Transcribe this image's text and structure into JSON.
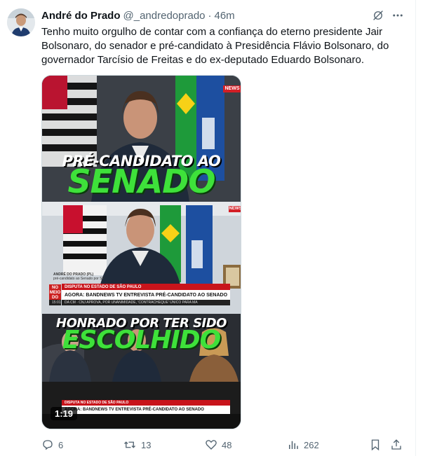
{
  "author": {
    "name": "André do Prado",
    "handle": "@_andredoprado",
    "separator": "·",
    "time": "46m"
  },
  "tweet": {
    "text": "Tenho muito orgulho de contar com a confiança do eterno presidente Jair Bolsonaro, do senador e pré-candidato à Presidência Flávio Bolsonaro, do governador Tarcísio de Freitas e do ex-deputado Eduardo Bolsonaro."
  },
  "video": {
    "duration": "1:19",
    "panel1": {
      "logo": "NEWS",
      "headline_white": "PRÉ-CANDIDATO AO",
      "headline_green": "SENADO"
    },
    "panel2": {
      "logo": "NEWS",
      "name_tag": "ANDRÉ DO PRADO (PL)",
      "name_sub": "pré-candidato ao Senado por SP",
      "live_badge": "NO MEIO DO DIA",
      "topic": "DISPUTA NO ESTADO DE SÃO PAULO",
      "headline": "AGORA: BANDNEWS TV ENTREVISTA PRÉ-CANDIDATO AO SENADO",
      "clock": "15:01",
      "crawl": "DA CM  ·  CNJ APROVA, POR UNANIMIDADE, 'CONTRACHEQUE' ÚNICO PARA MA",
      "headline_white": "HONRADO POR TER SIDO",
      "headline_green": "ESCOLHIDO"
    },
    "panel3": {
      "topic": "DISPUTA NO ESTADO DE SÃO PAULO",
      "headline": "AGORA: BANDNEWS TV ENTREVISTA PRÉ-CANDIDATO AO SENADO"
    }
  },
  "actions": {
    "replies": "6",
    "reposts": "13",
    "likes": "48",
    "views": "262"
  },
  "icons": {
    "grok": "grok-icon",
    "more": "more-icon",
    "reply": "reply-icon",
    "repost": "repost-icon",
    "like": "heart-icon",
    "views": "views-icon",
    "bookmark": "bookmark-icon",
    "share": "share-icon"
  },
  "colors": {
    "text": "#0f1419",
    "muted": "#536471",
    "green_title": "#3ee13a",
    "red_ticker": "#c8141b"
  }
}
